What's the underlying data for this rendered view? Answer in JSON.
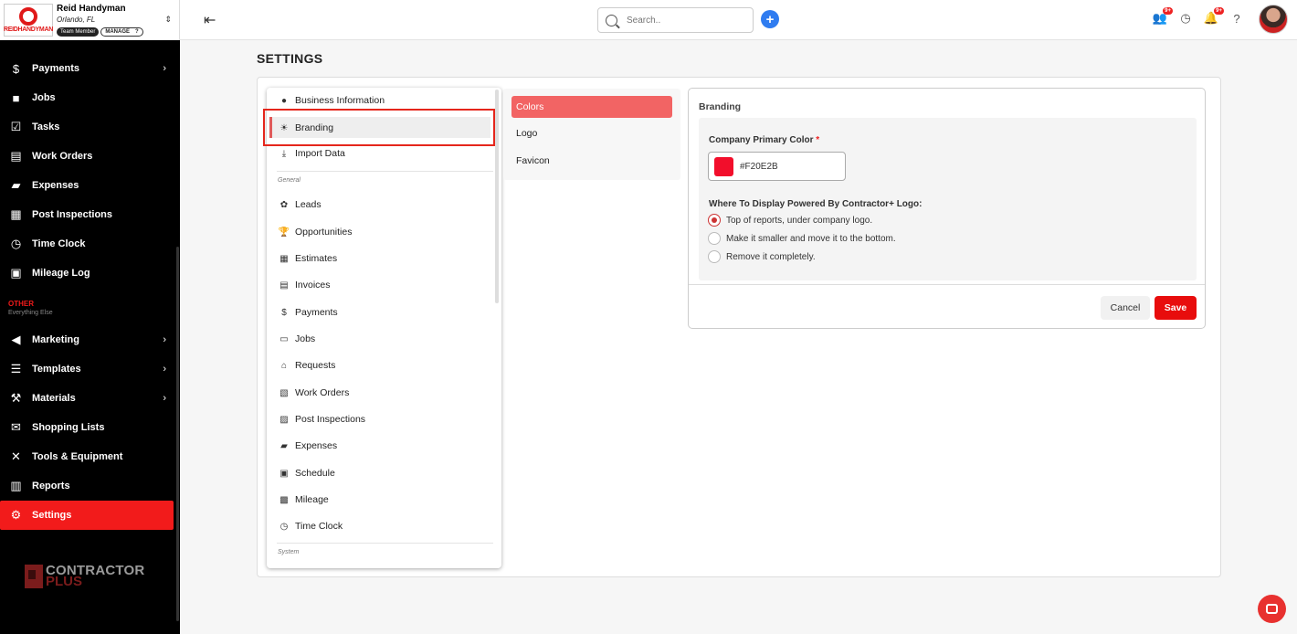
{
  "brand": {
    "name": "Reid Handyman",
    "location": "Orlando, FL",
    "role_badge": "Team Member",
    "manage_label": "MANAGE",
    "logo_word": "REIDHANDYMAN"
  },
  "sidebar": {
    "items": [
      {
        "label": "Payments",
        "icon": "payments-icon",
        "chevron": true
      },
      {
        "label": "Jobs",
        "icon": "briefcase-icon",
        "chevron": false
      },
      {
        "label": "Tasks",
        "icon": "checklist-icon",
        "chevron": false
      },
      {
        "label": "Work Orders",
        "icon": "work-orders-icon",
        "chevron": false
      },
      {
        "label": "Expenses",
        "icon": "wallet-icon",
        "chevron": false
      },
      {
        "label": "Post Inspections",
        "icon": "inspection-icon",
        "chevron": false
      },
      {
        "label": "Time Clock",
        "icon": "clock-icon",
        "chevron": false
      },
      {
        "label": "Mileage Log",
        "icon": "mileage-icon",
        "chevron": false
      }
    ],
    "section_title": "OTHER",
    "section_subtitle": "Everything Else",
    "other_items": [
      {
        "label": "Marketing",
        "icon": "megaphone-icon",
        "chevron": true
      },
      {
        "label": "Templates",
        "icon": "templates-icon",
        "chevron": true
      },
      {
        "label": "Materials",
        "icon": "materials-icon",
        "chevron": true
      },
      {
        "label": "Shopping Lists",
        "icon": "shopping-list-icon",
        "chevron": false
      },
      {
        "label": "Tools & Equipment",
        "icon": "tools-icon",
        "chevron": false
      },
      {
        "label": "Reports",
        "icon": "reports-icon",
        "chevron": false
      },
      {
        "label": "Settings",
        "icon": "gear-icon",
        "chevron": false,
        "active": true
      }
    ],
    "footer_logo": {
      "line1": "CONTRACTOR",
      "line2": "PLUS"
    }
  },
  "topbar": {
    "search_placeholder": "Search..",
    "add_label": "+",
    "notification_badges": [
      "9+",
      "9+"
    ]
  },
  "page": {
    "title": "SETTINGS"
  },
  "settings_menu": {
    "top_items": [
      {
        "label": "Business Information",
        "icon": "info-icon"
      },
      {
        "label": "Branding",
        "icon": "sun-icon",
        "active": true
      },
      {
        "label": "Import Data",
        "icon": "download-icon"
      }
    ],
    "general_title": "General",
    "general_items": [
      {
        "label": "Leads",
        "icon": "leads-icon"
      },
      {
        "label": "Opportunities",
        "icon": "trophy-icon"
      },
      {
        "label": "Estimates",
        "icon": "estimates-icon"
      },
      {
        "label": "Invoices",
        "icon": "invoice-icon"
      },
      {
        "label": "Payments",
        "icon": "payments-icon"
      },
      {
        "label": "Jobs",
        "icon": "briefcase-icon"
      },
      {
        "label": "Requests",
        "icon": "requests-icon"
      },
      {
        "label": "Work Orders",
        "icon": "work-orders-icon"
      },
      {
        "label": "Post Inspections",
        "icon": "inspection-icon"
      },
      {
        "label": "Expenses",
        "icon": "wallet-icon"
      },
      {
        "label": "Schedule",
        "icon": "calendar-icon"
      },
      {
        "label": "Mileage",
        "icon": "mileage-icon"
      },
      {
        "label": "Time Clock",
        "icon": "clock-icon"
      }
    ],
    "system_title": "System"
  },
  "subtabs": [
    {
      "label": "Colors",
      "active": true
    },
    {
      "label": "Logo",
      "active": false
    },
    {
      "label": "Favicon",
      "active": false
    }
  ],
  "branding": {
    "title": "Branding",
    "primary_color_label": "Company Primary Color",
    "required_mark": "*",
    "primary_color_value": "#F20E2B",
    "primary_color_hex": "#F20E2B",
    "display_logo_label": "Where To Display Powered By Contractor+ Logo:",
    "options": [
      {
        "label": "Top of reports, under company logo.",
        "checked": true
      },
      {
        "label": "Make it smaller and move it to the bottom.",
        "checked": false
      },
      {
        "label": "Remove it completely.",
        "checked": false
      }
    ],
    "cancel_label": "Cancel",
    "save_label": "Save"
  },
  "colors": {
    "accent": "#f21b1b",
    "active_subtab": "#f26464",
    "save": "#e80d0d",
    "highlight": "#e5261c"
  }
}
